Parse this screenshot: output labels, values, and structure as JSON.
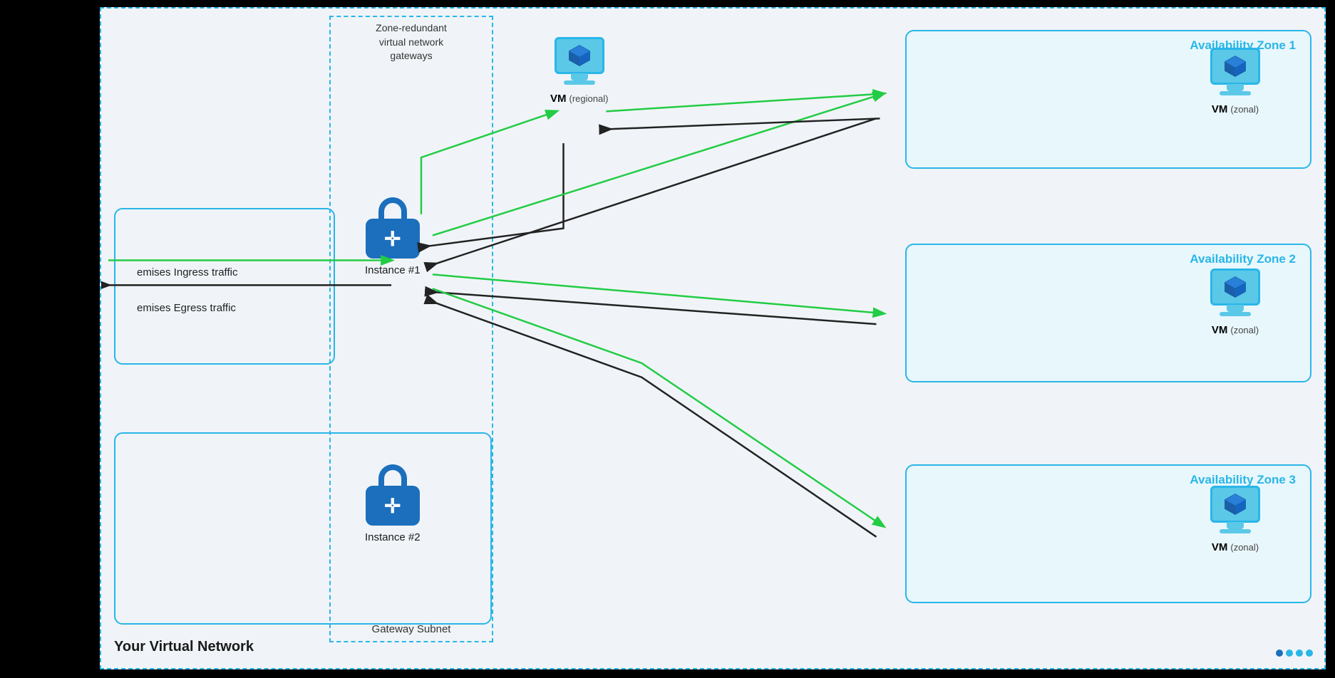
{
  "diagram": {
    "background_color": "#f0f4f8",
    "border_color": "#29b6e8",
    "vnet_label": "Your Virtual Network",
    "gateway_subnet_label": "Gateway Subnet",
    "zone_redundant_label": "Zone-redundant\nvirtual network\ngateways",
    "traffic": {
      "ingress_label": "emises Ingress traffic",
      "egress_label": "emises Egress traffic"
    },
    "instances": [
      {
        "id": "instance1",
        "label": "Instance #1"
      },
      {
        "id": "instance2",
        "label": "Instance #2"
      }
    ],
    "vms": [
      {
        "id": "vm-regional",
        "label": "VM",
        "sublabel": "(regional)"
      },
      {
        "id": "vm-az1",
        "label": "VM",
        "sublabel": "(zonal)"
      },
      {
        "id": "vm-az2",
        "label": "VM",
        "sublabel": "(zonal)"
      },
      {
        "id": "vm-az3",
        "label": "VM",
        "sublabel": "(zonal)"
      }
    ],
    "availability_zones": [
      {
        "id": "az1",
        "label": "Availability Zone 1"
      },
      {
        "id": "az2",
        "label": "Availability Zone 2"
      },
      {
        "id": "az3",
        "label": "Availability Zone 3"
      }
    ],
    "arrow_colors": {
      "green": "#22cc44",
      "black": "#222222"
    },
    "nav_dots": [
      "dot1",
      "dot2",
      "dot3"
    ]
  }
}
